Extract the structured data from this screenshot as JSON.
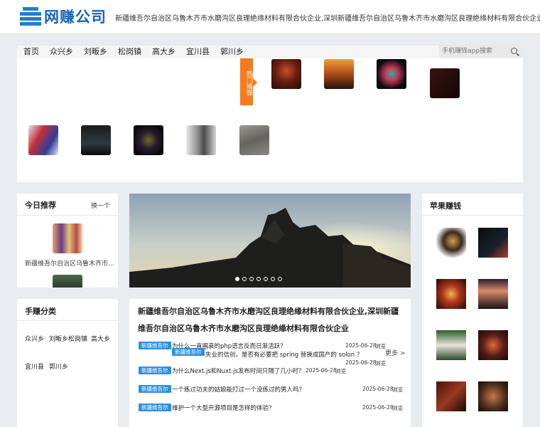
{
  "header": {
    "logo_text": "网赚公司",
    "title": "新疆维吾尔自治区乌鲁木齐市水磨沟区良理绝缘材料有限合伙企业,深圳新疆维吾尔自治区乌鲁木齐市水磨沟区良理绝缘材料有限合伙企业"
  },
  "nav": {
    "items": [
      "首页",
      "众兴乡",
      "刘畈乡",
      "松岗镇",
      "高大乡",
      "宜川县",
      "郭川乡"
    ]
  },
  "search": {
    "placeholder": "手机赚钱app搜索",
    "icon": "search-icon"
  },
  "hot": {
    "label": "热门推荐"
  },
  "today": {
    "title": "今日推荐",
    "switch_label": "换一个",
    "item_caption": "新疆维吾尔自治区乌鲁木齐市..."
  },
  "categories": {
    "title": "手赚分类",
    "rows": [
      [
        "众兴乡",
        "刘畈乡松岗镇",
        "高大乡"
      ],
      [
        "宜川县",
        "郭川乡"
      ]
    ]
  },
  "carousel": {
    "dot_count": 7,
    "active_index": 0
  },
  "news": {
    "heading": "新疆维吾尔自治区乌鲁木齐市水磨沟区良理绝缘材料有限合伙企业,深圳新疆维吾尔自治区乌鲁木齐市水磨沟区良理绝缘材料有限合伙企业",
    "more_label": "更多 >",
    "items": [
      {
        "tag": "新疆维吾尔",
        "title": "为什么一直唱衰的php语言反而日渐活跃？",
        "date": "2025-06-28",
        "views": "浏览"
      },
      {
        "tag": "新疆维吾尔",
        "title": "失业的信创，是否有必要把 spring 替换成国产的 solon ？",
        "date": "2025-06-28",
        "views": "浏览"
      },
      {
        "tag": "新疆维吾尔",
        "title": "为什么Next.js和Nuxt.js发布时间只隔了几小时？",
        "date": "2025-06-28",
        "views": "浏览"
      },
      {
        "tag": "新疆维吾尔",
        "title": "一个练过功夫的姑娘能打过一个没练过的男人吗？",
        "date": "2025-06-28",
        "views": "浏览"
      },
      {
        "tag": "新疆维吾尔",
        "title": "维护一个大型开源项目是怎样的体验？",
        "date": "2025-06-28",
        "views": "浏览"
      }
    ]
  },
  "right": {
    "title": "苹果赚钱"
  }
}
